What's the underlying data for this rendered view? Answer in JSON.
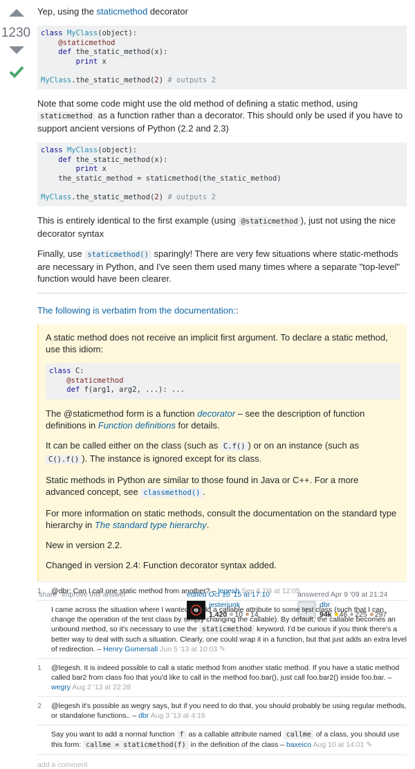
{
  "vote": {
    "score": "1230"
  },
  "answer": {
    "p1_a": "Yep, using the ",
    "p1_link": "staticmethod",
    "p1_b": " decorator",
    "code1": [
      [
        {
          "t": "kw",
          "v": "class "
        },
        {
          "t": "cls",
          "v": "MyClass"
        },
        {
          "t": "",
          "v": "(object):"
        }
      ],
      [
        {
          "t": "",
          "v": "    "
        },
        {
          "t": "dec",
          "v": "@staticmethod"
        }
      ],
      [
        {
          "t": "",
          "v": "    "
        },
        {
          "t": "kw",
          "v": "def "
        },
        {
          "t": "",
          "v": "the_static_method(x):"
        }
      ],
      [
        {
          "t": "",
          "v": "        "
        },
        {
          "t": "kw",
          "v": "print "
        },
        {
          "t": "",
          "v": "x"
        }
      ],
      [
        {
          "t": "",
          "v": ""
        }
      ],
      [
        {
          "t": "cls",
          "v": "MyClass"
        },
        {
          "t": "",
          "v": ".the_static_method("
        },
        {
          "t": "num",
          "v": "2"
        },
        {
          "t": "",
          "v": ") "
        },
        {
          "t": "cm",
          "v": "# outputs 2"
        }
      ]
    ],
    "p2_a": "Note that some code might use the old method of defining a static method, using ",
    "p2_code": "staticmethod",
    "p2_b": " as a function rather than a decorator. This should only be used if you have to support ancient versions of Python (2.2 and 2.3)",
    "code2": [
      [
        {
          "t": "kw",
          "v": "class "
        },
        {
          "t": "cls",
          "v": "MyClass"
        },
        {
          "t": "",
          "v": "(object):"
        }
      ],
      [
        {
          "t": "",
          "v": "    "
        },
        {
          "t": "kw",
          "v": "def "
        },
        {
          "t": "",
          "v": "the_static_method(x):"
        }
      ],
      [
        {
          "t": "",
          "v": "        "
        },
        {
          "t": "kw",
          "v": "print "
        },
        {
          "t": "",
          "v": "x"
        }
      ],
      [
        {
          "t": "",
          "v": "    the_static_method = staticmethod(the_static_method)"
        }
      ],
      [
        {
          "t": "",
          "v": ""
        }
      ],
      [
        {
          "t": "cls",
          "v": "MyClass"
        },
        {
          "t": "",
          "v": ".the_static_method("
        },
        {
          "t": "num",
          "v": "2"
        },
        {
          "t": "",
          "v": ") "
        },
        {
          "t": "cm",
          "v": "# outputs 2"
        }
      ]
    ],
    "p3_a": "This is entirely identical to the first example (using ",
    "p3_code": "@staticmethod",
    "p3_b": "), just not using the nice decorator syntax",
    "p4_a": "Finally, use ",
    "p4_code": "staticmethod()",
    "p4_b": " sparingly! There are very few situations where static-methods are necessary in Python, and I've seen them used many times where a separate \"top-level\" function would have been clearer.",
    "p5_link": "The following is verbatim from the documentation:",
    "p5_b": ":",
    "quote": {
      "q1": "A static method does not receive an implicit first argument. To declare a static method, use this idiom:",
      "code": [
        [
          {
            "t": "kw",
            "v": "class "
          },
          {
            "t": "",
            "v": "C:"
          }
        ],
        [
          {
            "t": "",
            "v": "    "
          },
          {
            "t": "dec",
            "v": "@staticmethod"
          }
        ],
        [
          {
            "t": "",
            "v": "    "
          },
          {
            "t": "kw",
            "v": "def "
          },
          {
            "t": "",
            "v": "f(arg1, arg2, ...): ..."
          }
        ]
      ],
      "q2_a": "The @staticmethod form is a function ",
      "q2_link1": "decorator",
      "q2_b": " – see the description of function definitions in ",
      "q2_link2": "Function definitions",
      "q2_c": " for details.",
      "q3_a": "It can be called either on the class (such as ",
      "q3_code1": "C.f()",
      "q3_b": ") or on an instance (such as ",
      "q3_code2": "C().f()",
      "q3_c": "). The instance is ignored except for its class.",
      "q4_a": "Static methods in Python are similar to those found in Java or C++. For a more advanced concept, see ",
      "q4_code": "classmethod()",
      "q4_b": ".",
      "q5_a": "For more information on static methods, consult the documentation on the standard type hierarchy in ",
      "q5_link": "The standard type hierarchy",
      "q5_b": ".",
      "q6": "New in version 2.2.",
      "q7": "Changed in version 2.4: Function decorator syntax added."
    }
  },
  "post_menu": {
    "share": "share",
    "improve": "improve this answer"
  },
  "editor": {
    "action": "edited Oct 15 '15 at 17:10",
    "name": "jesterjunk",
    "rep": "1,420",
    "silver": "10",
    "bronze": "14"
  },
  "author": {
    "action": "answered Apr 9 '09 at 21:24",
    "name": "dbr",
    "rep": "94k",
    "gold": "46",
    "silver": "225",
    "bronze": "297"
  },
  "comments": [
    {
      "score": "1",
      "text": "@dbr: Can I call one static method from another? – ",
      "user": "legesh",
      "date": " Sep 6 '09 at 12:05"
    },
    {
      "score": "",
      "text_a": "I came across the situation where I wanted to add a callable attribute to some test class (such that I can change the operation of the test class by simply changing the callable). By default, the callable becomes an unbound method, so it's necessary to use the ",
      "code": "staticmethod",
      "text_b": " keyword. I'd be curious if you think there's a better way to deal with such a situation. Clearly, one could wrap it in a function, but that just adds an extra level of redirection. – ",
      "user": "Henry Gomersall",
      "date": " Jun 5 '13 at 10:03"
    },
    {
      "score": "1",
      "text": "@legesh. It is indeed possible to call a static method from another static method. If you have a static method called bar2 from class foo that you'd like to call in the method foo.bar(), just call foo.bar2() inside foo.bar. – ",
      "user": "wegry",
      "date": " Aug 2 '13 at 22:28"
    },
    {
      "score": "2",
      "text": "@legesh it's possible as wegry says, but if you need to do that, you should probably be using regular methods, or standalone functions.. – ",
      "user": "dbr",
      "date": " Aug 3 '13 at 4:16"
    },
    {
      "score": "",
      "text_a": "Say you want to add a normal function ",
      "code1": "f",
      "text_b": " as a callable attribute named ",
      "code2": "callme",
      "text_c": " of a class, you should use this form: ",
      "code3": "callme = staticmethod(f)",
      "text_d": " in the definition of the class – ",
      "user": "baxeico",
      "date": " Aug 10 at 14:01"
    }
  ],
  "add_comment": "add a comment",
  "colors": {
    "accent": "#0c65a5",
    "accepted": "#48a868",
    "quote_bg": "#fff8dc",
    "code_bg": "#eff0f1",
    "gold": "#ffcc01",
    "silver": "#b4b8bc",
    "bronze": "#d1a684"
  },
  "icons": [
    "upvote-arrow-icon",
    "downvote-arrow-icon",
    "accepted-check-icon",
    "pencil-icon"
  ]
}
